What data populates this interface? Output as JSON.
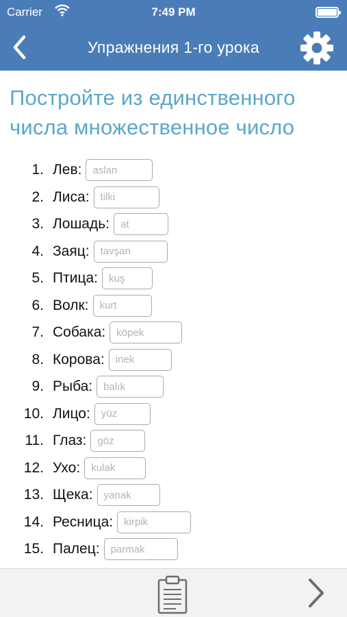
{
  "status": {
    "carrier": "Carrier",
    "time": "7:49 PM"
  },
  "nav": {
    "title": "Упражнения 1-го урока"
  },
  "heading": "Постройте из единственного числа множественное число",
  "items": [
    {
      "num": "1.",
      "word": "Лев:",
      "placeholder": "aslan"
    },
    {
      "num": "2.",
      "word": "Лиса:",
      "placeholder": "tilki"
    },
    {
      "num": "3.",
      "word": "Лошадь:",
      "placeholder": "at"
    },
    {
      "num": "4.",
      "word": "Заяц:",
      "placeholder": "tavşan"
    },
    {
      "num": "5.",
      "word": "Птица:",
      "placeholder": "kuş"
    },
    {
      "num": "6.",
      "word": "Волк:",
      "placeholder": "kurt"
    },
    {
      "num": "7.",
      "word": "Собака:",
      "placeholder": "köpek"
    },
    {
      "num": "8.",
      "word": "Корова:",
      "placeholder": "inek"
    },
    {
      "num": "9.",
      "word": "Рыба:",
      "placeholder": "balık"
    },
    {
      "num": "10.",
      "word": "Лицо:",
      "placeholder": "yüz"
    },
    {
      "num": "11.",
      "word": "Глаз:",
      "placeholder": "göz"
    },
    {
      "num": "12.",
      "word": "Ухо:",
      "placeholder": "kulak"
    },
    {
      "num": "13.",
      "word": "Щека:",
      "placeholder": "yanak"
    },
    {
      "num": "14.",
      "word": "Ресница:",
      "placeholder": "kirpik"
    },
    {
      "num": "15.",
      "word": "Палец:",
      "placeholder": "parmak"
    }
  ],
  "icons": {
    "back": "chevron-left-icon",
    "settings": "gear-icon",
    "clipboard": "clipboard-icon",
    "next": "chevron-right-icon",
    "wifi": "wifi-icon",
    "battery": "battery-icon"
  },
  "colors": {
    "nav_background": "#4a7db8",
    "heading": "#5aa7c9",
    "bottom_bar": "#f2f2f2"
  }
}
